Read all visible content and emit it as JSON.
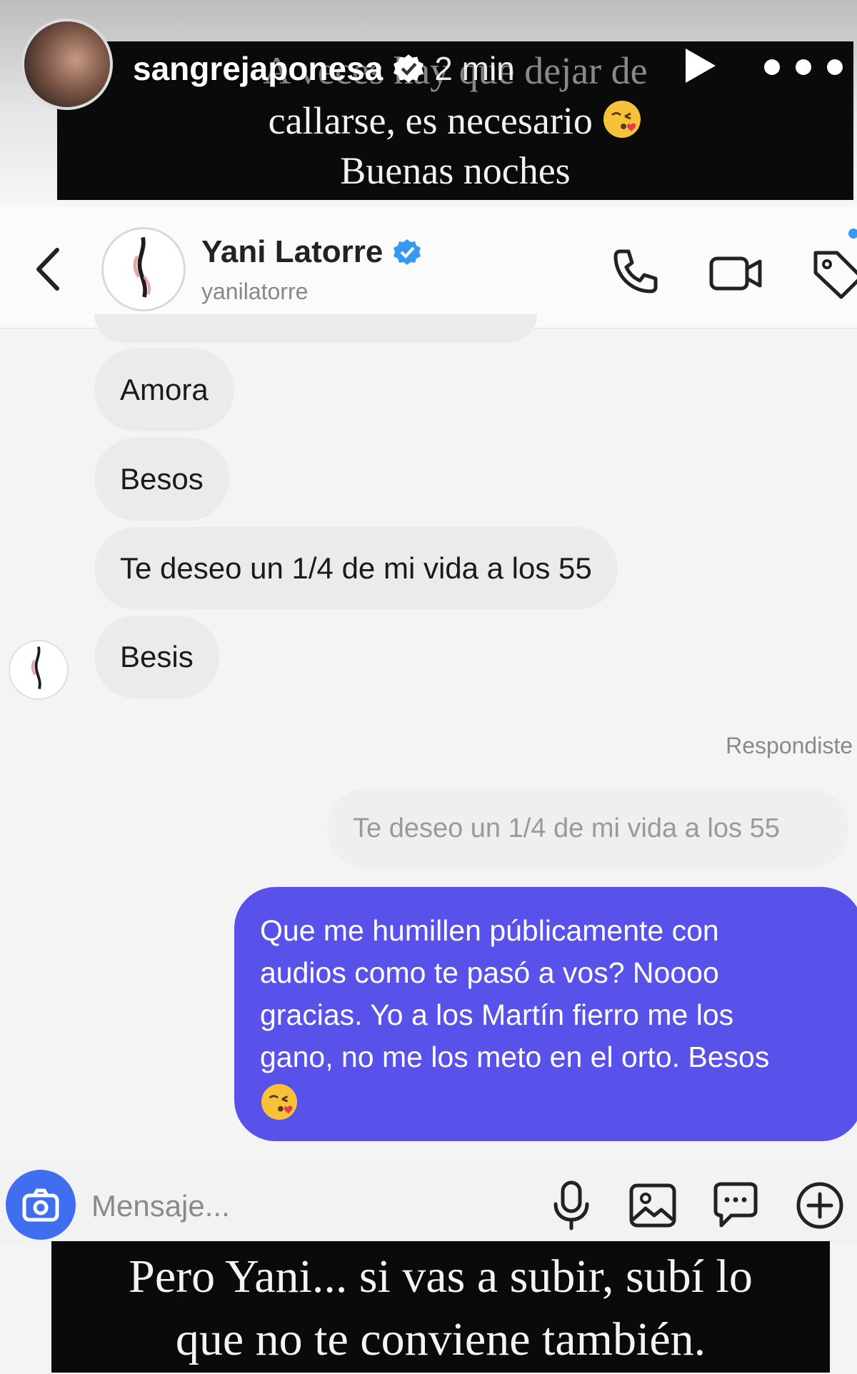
{
  "story": {
    "username": "sangrejaponesa",
    "time": "2 min",
    "caption_lines": [
      "A veces hay que dejar de",
      "callarse, es necesario",
      "Buenas noches"
    ]
  },
  "dm_header": {
    "name": "Yani Latorre",
    "handle": "yanilatorre"
  },
  "messages_in": [
    {
      "text": "Amora"
    },
    {
      "text": "Besos"
    },
    {
      "text": "Te deseo un 1/4 de mi vida a los 55"
    },
    {
      "text": "Besis"
    }
  ],
  "reply": {
    "label": "Respondiste",
    "quoted": "Te deseo un 1/4 de mi vida a los 55",
    "lines": [
      "Que me humillen públicamente con",
      "audios como te pasó a vos? Noooo",
      "gracias. Yo a los Martín fierro me los",
      "gano, no me los meto en el orto. Besos"
    ]
  },
  "composer": {
    "placeholder": "Mensaje..."
  },
  "bottom_caption": {
    "lines": [
      "Pero Yani... si vas a subir, subí lo",
      "que no te conviene también."
    ]
  },
  "colors": {
    "outgoing_bubble": "#5851ea",
    "incoming_bubble": "#ebebeb",
    "verified": "#3897f0",
    "camera_button": "#3f6ff0"
  }
}
